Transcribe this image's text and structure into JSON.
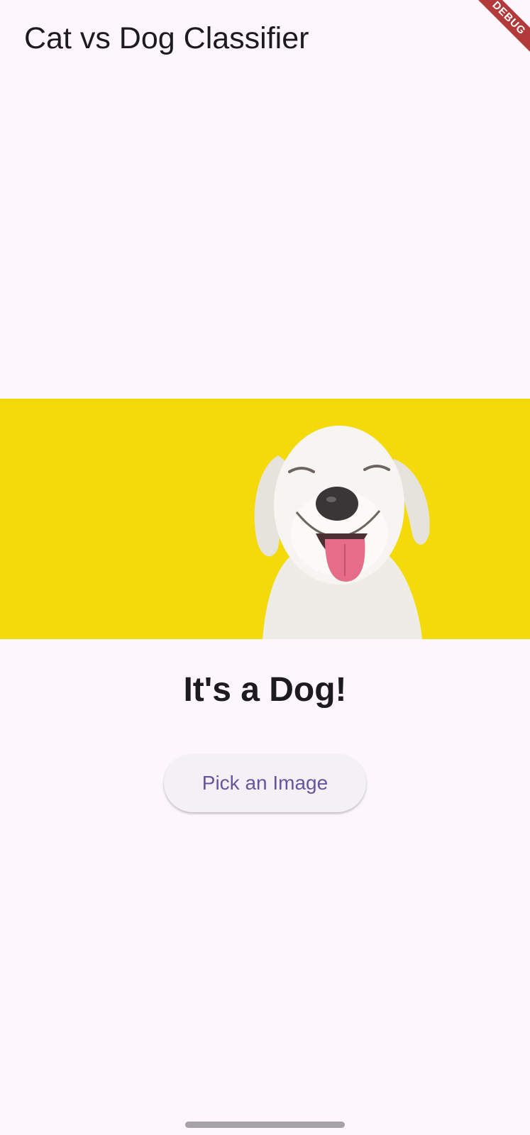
{
  "app_bar": {
    "title": "Cat vs Dog Classifier",
    "debug_banner": "DEBUG"
  },
  "photo": {
    "background_color": "#f4da0a",
    "subject": "dog-photo"
  },
  "result": {
    "text": "It's a Dog!"
  },
  "actions": {
    "pick_image_label": "Pick an Image"
  },
  "colors": {
    "background": "#fdf7fd",
    "accent": "#65559f",
    "button_background": "#f4f1f6"
  }
}
